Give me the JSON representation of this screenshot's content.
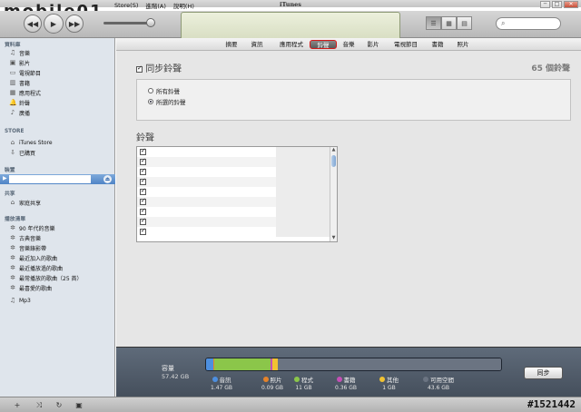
{
  "window": {
    "title": "iTunes",
    "watermark_logo": "mobile01",
    "watermark_id": "#1521442"
  },
  "menu": [
    "Store(S)",
    "進階(A)",
    "說明(H)"
  ],
  "window_controls": [
    "─",
    "□",
    "✕"
  ],
  "toolbar": {
    "apple_glyph": "",
    "view_icons": [
      "☰",
      "▦",
      "▤"
    ]
  },
  "sidebar": {
    "library_head": "資料庫",
    "library": [
      {
        "label": "音樂",
        "icon": "♫"
      },
      {
        "label": "影片",
        "icon": "▣"
      },
      {
        "label": "電視節目",
        "icon": "▭"
      },
      {
        "label": "書籍",
        "icon": "▥"
      },
      {
        "label": "應用程式",
        "icon": "▦"
      },
      {
        "label": "鈴聲",
        "icon": "🔔"
      },
      {
        "label": "廣播",
        "icon": "♪"
      }
    ],
    "store_head": "STORE",
    "store": [
      {
        "label": "iTunes Store",
        "icon": "⌂"
      },
      {
        "label": "已購買",
        "icon": "⇩"
      }
    ],
    "device_head": "裝置",
    "shared_head": "共享",
    "shared": [
      {
        "label": "家庭共享",
        "icon": "⌂"
      }
    ],
    "playlists_head": "播放清單",
    "playlists": [
      {
        "label": "90 年代的音樂",
        "icon": "✲"
      },
      {
        "label": "古典音樂",
        "icon": "✲"
      },
      {
        "label": "音樂錄影帶",
        "icon": "✲"
      },
      {
        "label": "最近加入的歌曲",
        "icon": "✲"
      },
      {
        "label": "最近播放過的歌曲",
        "icon": "✲"
      },
      {
        "label": "最常播放的歌曲（25 首）",
        "icon": "✲"
      },
      {
        "label": "最喜愛的歌曲",
        "icon": "✲"
      },
      {
        "label": "Mp3",
        "icon": "♫"
      }
    ]
  },
  "bottom_bar": {
    "buttons": [
      "+",
      "⤨",
      "↻",
      "▣"
    ]
  },
  "tabs": [
    "摘要",
    "資訊",
    "應用程式",
    "鈴聲",
    "音樂",
    "影片",
    "電視節目",
    "書籍",
    "照片"
  ],
  "active_tab": "鈴聲",
  "ringtones": {
    "sync_label": "同步鈴聲",
    "sync_checked": true,
    "count_label": "65 個鈴聲",
    "option_all": "所有鈴聲",
    "option_selected": "所選的鈴聲",
    "selected_option": "option_selected",
    "list_title": "鈴聲",
    "rows_checked": [
      true,
      true,
      true,
      true,
      true,
      true,
      true,
      true,
      true
    ]
  },
  "capacity": {
    "label": "容量",
    "total": "57.42 GB",
    "segments": [
      {
        "name": "音訊",
        "value": "1.47 GB",
        "gb": 1.47,
        "color": "#4d8fe0"
      },
      {
        "name": "照片",
        "value": "0.09 GB",
        "gb": 0.09,
        "color": "#e5832a"
      },
      {
        "name": "程式",
        "value": "11 GB",
        "gb": 11,
        "color": "#8bc64a"
      },
      {
        "name": "書籍",
        "value": "0.36 GB",
        "gb": 0.36,
        "color": "#c44fb5"
      },
      {
        "name": "其他",
        "value": "1 GB",
        "gb": 1,
        "color": "#f1c232"
      },
      {
        "name": "可用空間",
        "value": "43.6 GB",
        "gb": 43.6,
        "color": "#6b7482"
      }
    ]
  },
  "sync_button": "同步"
}
